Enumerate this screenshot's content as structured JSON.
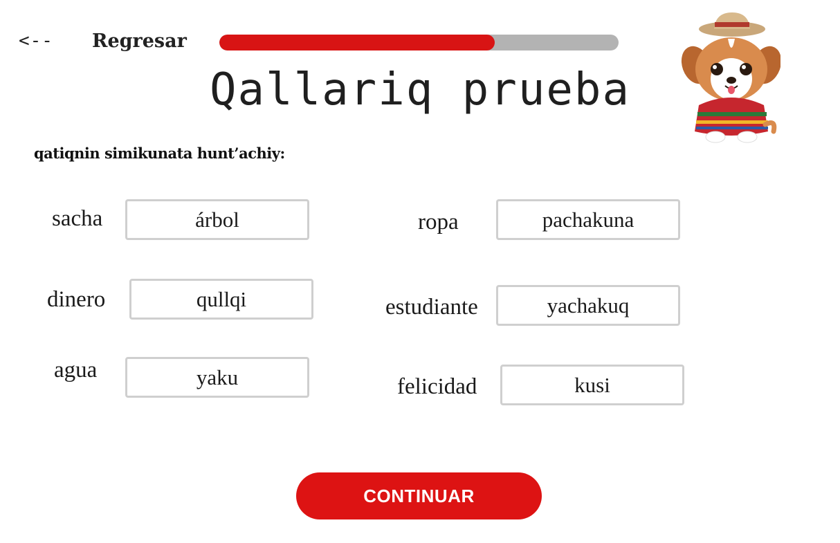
{
  "header": {
    "back_arrow": "<--",
    "back_label": "Regresar",
    "progress": 0.69,
    "progress_color": "#d81414",
    "track_color": "#b3b3b3"
  },
  "title": "Qallariq prueba",
  "mascot": {
    "icon": "puppy-mascot-icon"
  },
  "instruction": "qatiqnin simikunata hunt’achiy:",
  "pairs": [
    {
      "word": "sacha",
      "answer": "árbol"
    },
    {
      "word": "ropa",
      "answer": "pachakuna"
    },
    {
      "word": "dinero",
      "answer": "qullqi"
    },
    {
      "word": "estudiante",
      "answer": "yachakuq"
    },
    {
      "word": "agua",
      "answer": "yaku"
    },
    {
      "word": "felicidad",
      "answer": "kusi"
    }
  ],
  "continue_label": "CONTINUAR",
  "accent_color": "#dd1313"
}
